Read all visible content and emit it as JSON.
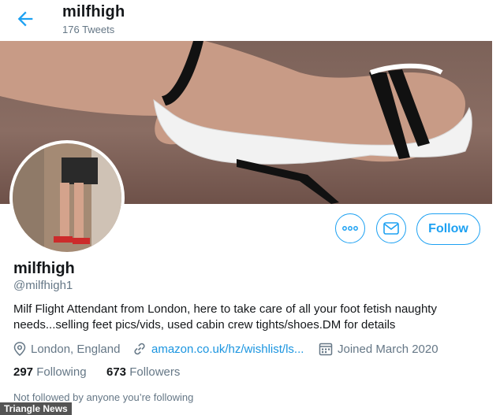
{
  "header": {
    "name": "milfhigh",
    "tweet_count": "176 Tweets"
  },
  "profile": {
    "name": "milfhigh",
    "handle": "@milfhigh1",
    "bio": "Milf Flight Attendant from London, here to take care of all your foot fetish naughty needs...selling feet pics/vids, used cabin crew tights/shoes.DM for details",
    "location": "London, England",
    "website": "amazon.co.uk/hz/wishlist/ls...",
    "joined": "Joined March 2020",
    "following_count": "297",
    "following_label": "Following",
    "followers_count": "673",
    "followers_label": "Followers",
    "not_followed": "Not followed by anyone you’re following"
  },
  "actions": {
    "follow_label": "Follow",
    "more_icon": "more-icon",
    "message_icon": "envelope-icon"
  },
  "watermark": "Triangle News",
  "colors": {
    "accent": "#1da1f2",
    "muted": "#657786"
  }
}
